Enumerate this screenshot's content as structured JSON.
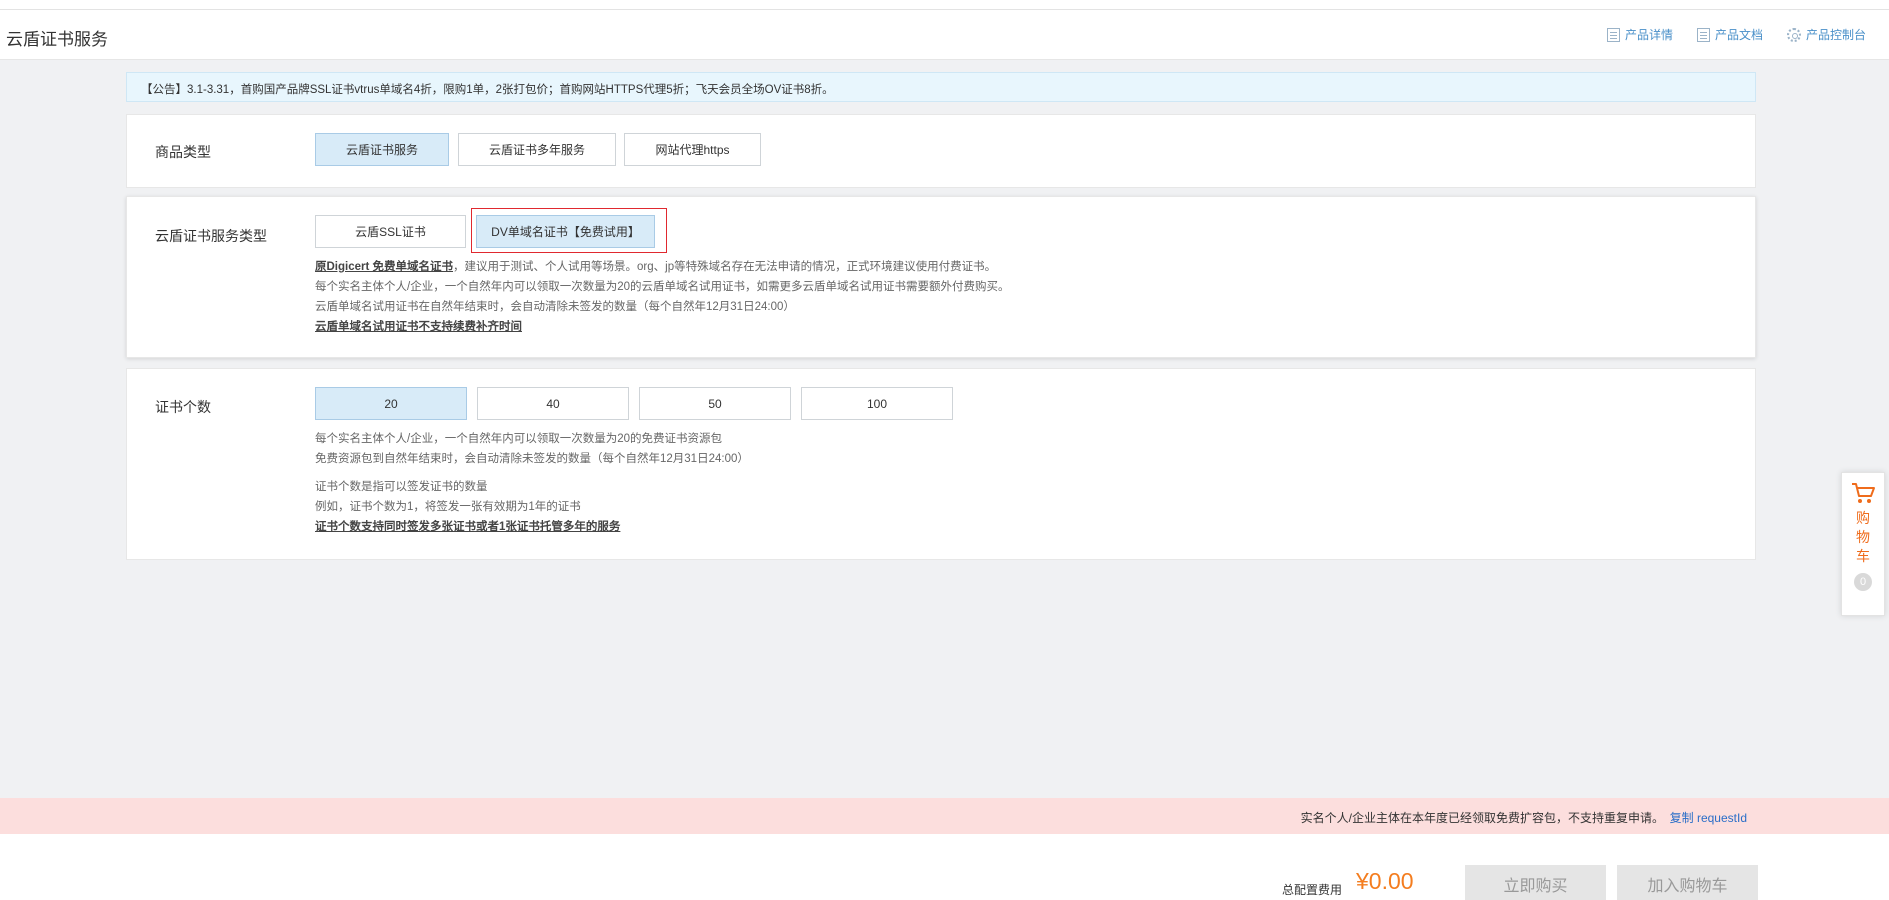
{
  "header": {
    "title": "云盾证书服务",
    "links": [
      {
        "label": "产品详情",
        "icon": "doc-icon"
      },
      {
        "label": "产品文档",
        "icon": "doc-icon"
      },
      {
        "label": "产品控制台",
        "icon": "gear-icon"
      }
    ]
  },
  "notice": "【公告】3.1-3.31，首购国产品牌SSL证书vtrus单域名4折，限购1单，2张打包价；首购网站HTTPS代理5折；飞天会员全场OV证书8折。",
  "product_type": {
    "label": "商品类型",
    "options": [
      "云盾证书服务",
      "云盾证书多年服务",
      "网站代理https"
    ],
    "selected": "云盾证书服务"
  },
  "service_type": {
    "label": "云盾证书服务类型",
    "options": [
      "云盾SSL证书",
      "DV单域名证书【免费试用】"
    ],
    "selected": "DV单域名证书【免费试用】",
    "desc": {
      "line1_link": "原Digicert 免费单域名证书",
      "line1_rest": "，建议用于测试、个人试用等场景。org、jp等特殊域名存在无法申请的情况，正式环境建议使用付费证书。",
      "line2": "每个实名主体个人/企业，一个自然年内可以领取一次数量为20的云盾单域名试用证书，如需更多云盾单域名试用证书需要额外付费购买。",
      "line3": "云盾单域名试用证书在自然年结束时，会自动清除未签发的数量（每个自然年12月31日24:00）",
      "line4_link": "云盾单域名试用证书不支持续费补齐时间"
    }
  },
  "cert_count": {
    "label": "证书个数",
    "options": [
      "20",
      "40",
      "50",
      "100"
    ],
    "selected": "20",
    "desc": {
      "line1": "每个实名主体个人/企业，一个自然年内可以领取一次数量为20的免费证书资源包",
      "line2": "免费资源包到自然年结束时，会自动清除未签发的数量（每个自然年12月31日24:00）",
      "line3": "证书个数是指可以签发证书的数量",
      "line4": "例如，证书个数为1，将签发一张有效期为1年的证书",
      "line5_link": "证书个数支持同时签发多张证书或者1张证书托管多年的服务"
    }
  },
  "cart": {
    "label": "购物车",
    "count": "0"
  },
  "alert": {
    "message": "实名个人/企业主体在本年度已经领取免费扩容包，不支持重复申请。",
    "copy_label": "复制 requestId"
  },
  "footer": {
    "total_label": "总配置费用",
    "total_price": "¥0.00",
    "buy_label": "立即购买",
    "add_cart_label": "加入购物车"
  },
  "colors": {
    "accent": "#f47d1f",
    "selected_bg": "#d8ebf8",
    "link": "#4a90c9",
    "alert_bg": "#fcdedd",
    "highlight_border": "#e0292f"
  }
}
